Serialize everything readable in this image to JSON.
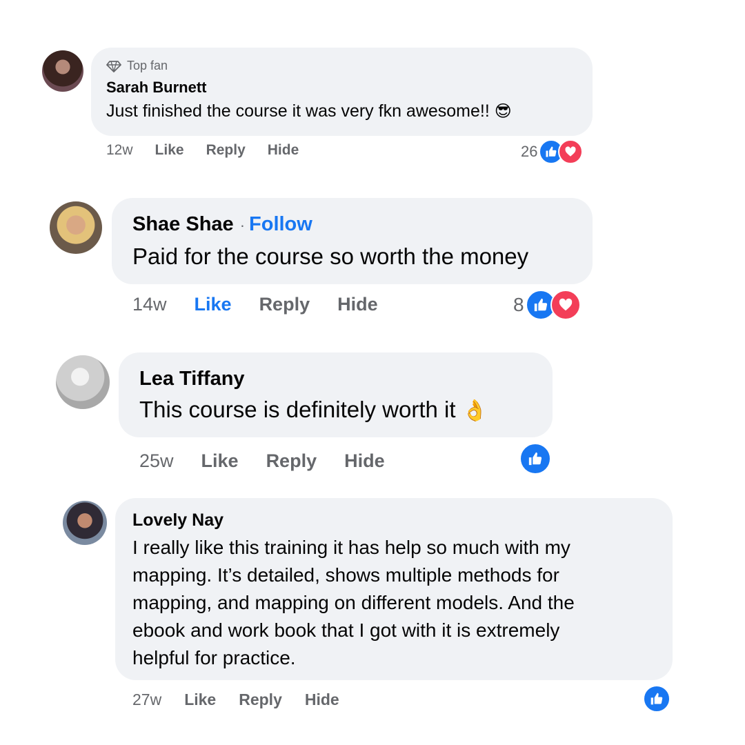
{
  "comments": [
    {
      "badge": "Top fan",
      "author": "Sarah Burnett",
      "text": "Just finished the course it was very fkn awesome!! ",
      "emoji": "😎",
      "time": "12w",
      "like": "Like",
      "reply": "Reply",
      "hide": "Hide",
      "reactions_count": "26",
      "reactions": [
        "like-icon",
        "love-icon"
      ]
    },
    {
      "author": "Shae Shae",
      "separator": "·",
      "follow": "Follow",
      "text": "Paid for the course so worth the money",
      "time": "14w",
      "like": "Like",
      "liked": true,
      "reply": "Reply",
      "hide": "Hide",
      "reactions_count": "8",
      "reactions": [
        "like-icon",
        "love-icon"
      ]
    },
    {
      "author": "Lea Tiffany",
      "text": "This course is definitely worth it ",
      "emoji": "👌",
      "time": "25w",
      "like": "Like",
      "reply": "Reply",
      "hide": "Hide",
      "reactions": [
        "like-icon"
      ]
    },
    {
      "author": "Lovely Nay",
      "text_lines": [
        "I really like this training it has help so much with my",
        "mapping. It’s detailed, shows multiple methods for",
        "mapping, and mapping on different models. And the",
        "ebook and work book that I got with it is extremely",
        "helpful for practice."
      ],
      "time": "27w",
      "like": "Like",
      "reply": "Reply",
      "hide": "Hide",
      "reactions": [
        "like-icon"
      ]
    }
  ],
  "colors": {
    "bubble": "#f0f2f5",
    "accent": "#1877f2",
    "love": "#f33e58",
    "secondary_text": "#65676b"
  }
}
